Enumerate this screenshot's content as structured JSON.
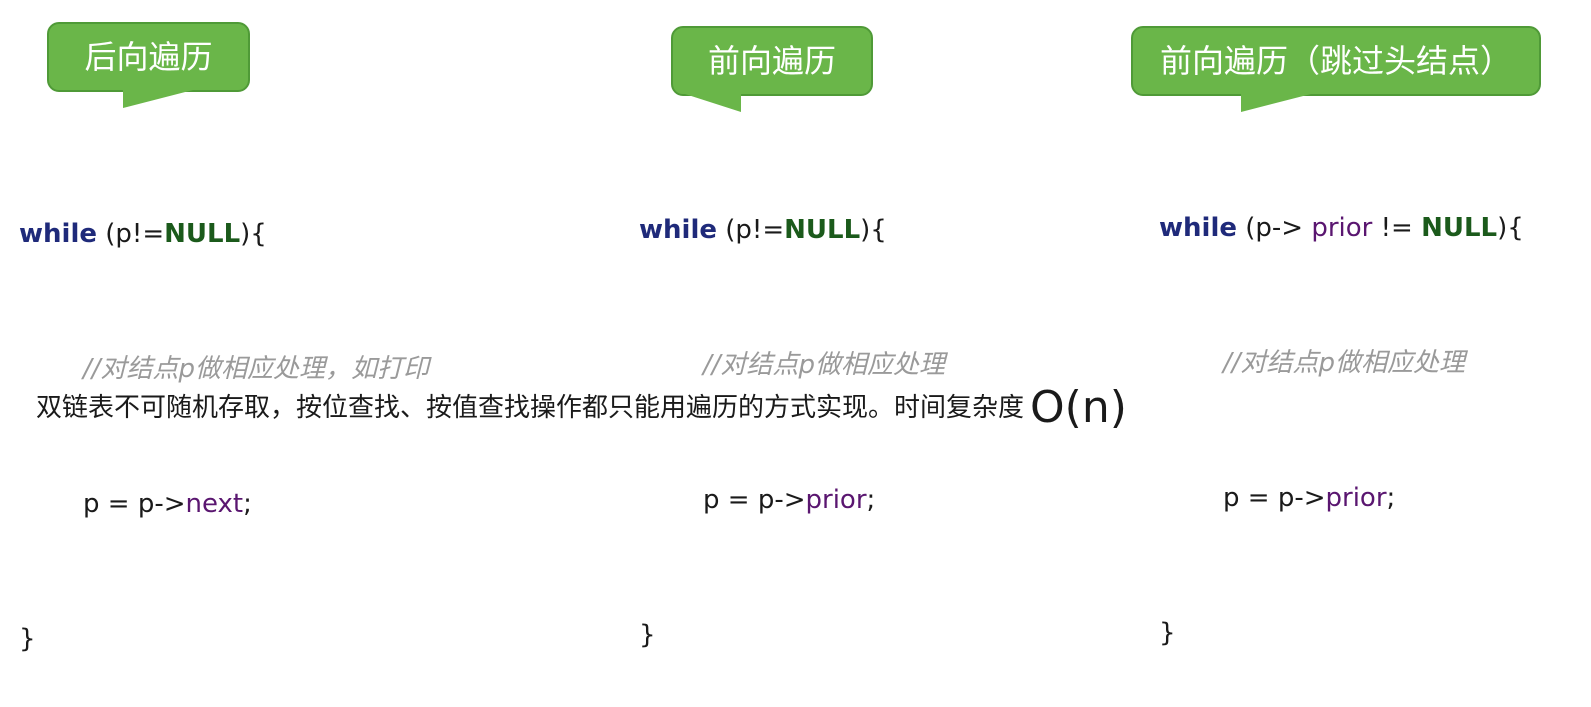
{
  "callouts": [
    {
      "label": "后向遍历"
    },
    {
      "label": "前向遍历"
    },
    {
      "label": "前向遍历（跳过头结点）"
    }
  ],
  "code_blocks": [
    {
      "while_kw": "while",
      "cond_prefix": " (p!=",
      "null_kw": "NULL",
      "cond_suffix": "){",
      "comment": "//对结点p做相应处理，如打印",
      "assign_prefix": "p = p->",
      "member": "next",
      "assign_suffix": ";",
      "close": "}"
    },
    {
      "while_kw": "while",
      "cond_prefix": " (p!=",
      "null_kw": "NULL",
      "cond_suffix": "){",
      "comment": "//对结点p做相应处理",
      "assign_prefix": "p = p->",
      "member": "prior",
      "assign_suffix": ";",
      "close": "}"
    },
    {
      "while_kw": "while",
      "cond_prefix": " (p-> ",
      "cond_member": "prior",
      "cond_mid": " != ",
      "null_kw": "NULL",
      "cond_suffix": "){",
      "comment": "//对结点p做相应处理",
      "assign_prefix": "p = p->",
      "member": "prior",
      "assign_suffix": ";",
      "close": "}"
    }
  ],
  "summary": {
    "text": "双链表不可随机存取，按位查找、按值查找操作都只能用遍历的方式实现。时间复杂度",
    "complexity": "O(n)"
  },
  "colors": {
    "callout_fill": "#6ab649",
    "keyword": "#1f2a7a",
    "null": "#1b5a1b",
    "member": "#5a1670",
    "comment": "#9a9a9a"
  }
}
